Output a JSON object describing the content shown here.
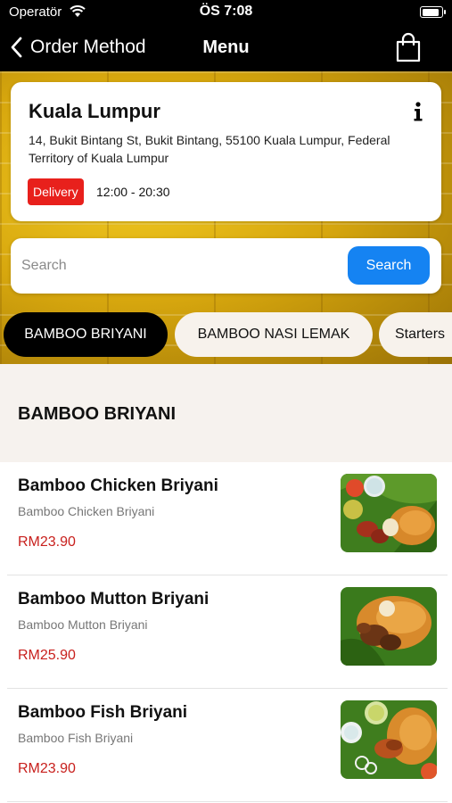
{
  "status_bar": {
    "carrier": "Operatör",
    "time": "ÖS 7:08",
    "battery_level": 0.9
  },
  "nav": {
    "back_label": "Order Method",
    "title": "Menu",
    "cart_icon": "shopping-bag-icon"
  },
  "store": {
    "name": "Kuala Lumpur",
    "address": "14, Bukit Bintang St, Bukit Bintang, 55100 Kuala Lumpur, Federal Territory of Kuala Lumpur",
    "badge": "Delivery",
    "hours": "12:00 - 20:30"
  },
  "search": {
    "placeholder": "Search",
    "value": "",
    "button_label": "Search"
  },
  "tabs": [
    {
      "label": "BAMBOO BRIYANI",
      "active": true
    },
    {
      "label": "BAMBOO NASI LEMAK",
      "active": false
    },
    {
      "label": "Starters",
      "active": false
    }
  ],
  "section": {
    "title": "BAMBOO BRIYANI"
  },
  "items": [
    {
      "name": "Bamboo Chicken Briyani",
      "description": "Bamboo Chicken Briyani",
      "price": "RM23.90"
    },
    {
      "name": "Bamboo Mutton Briyani",
      "description": "Bamboo Mutton Briyani",
      "price": "RM25.90"
    },
    {
      "name": "Bamboo Fish Briyani",
      "description": "Bamboo Fish Briyani",
      "price": "RM23.90"
    }
  ],
  "colors": {
    "accent_blue": "#1583f2",
    "badge_red": "#e8201c",
    "price_red": "#c8201d",
    "nav_black": "#000000"
  }
}
